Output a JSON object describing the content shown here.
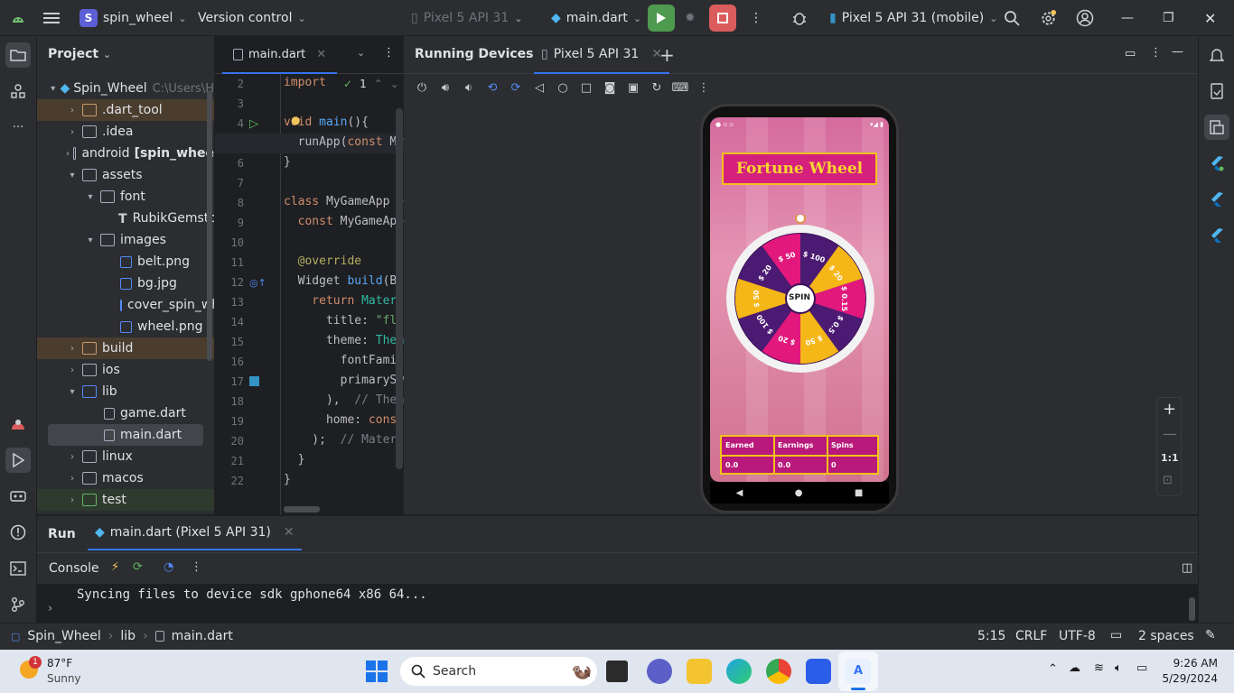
{
  "topbar": {
    "project_badge": "S",
    "project_name": "spin_wheel",
    "vcs": "Version control",
    "device_selector": "Pixel 5 API 31",
    "run_config": "main.dart",
    "target_device": "Pixel 5 API 31 (mobile)"
  },
  "project_panel": {
    "title": "Project",
    "root_name": "Spin_Wheel",
    "root_path": "C:\\Users\\H",
    "items": [
      {
        "label": ".dart_tool",
        "extra": ""
      },
      {
        "label": ".idea",
        "extra": ""
      },
      {
        "label": "android",
        "extra": "[spin_whee"
      },
      {
        "label": "assets",
        "extra": ""
      },
      {
        "label": "font",
        "extra": ""
      },
      {
        "label": "RubikGemstor",
        "extra": ""
      },
      {
        "label": "images",
        "extra": ""
      },
      {
        "label": "belt.png",
        "extra": ""
      },
      {
        "label": "bg.jpg",
        "extra": ""
      },
      {
        "label": "cover_spin_wh",
        "extra": ""
      },
      {
        "label": "wheel.png",
        "extra": ""
      },
      {
        "label": "build",
        "extra": ""
      },
      {
        "label": "ios",
        "extra": ""
      },
      {
        "label": "lib",
        "extra": ""
      },
      {
        "label": "game.dart",
        "extra": ""
      },
      {
        "label": "main.dart",
        "extra": ""
      },
      {
        "label": "linux",
        "extra": ""
      },
      {
        "label": "macos",
        "extra": ""
      },
      {
        "label": "test",
        "extra": ""
      }
    ]
  },
  "editor": {
    "tab": "main.dart",
    "problems_count": "1",
    "line_numbers": [
      "2",
      "3",
      "4",
      "5",
      "6",
      "7",
      "8",
      "9",
      "10",
      "11",
      "12",
      "13",
      "14",
      "15",
      "16",
      "17",
      "18",
      "19",
      "20",
      "21",
      "22"
    ],
    "lines": {
      "l2": "import",
      "l4a": "void",
      "l4b": "main",
      "l4c": "(){",
      "l5a": "  runApp(",
      "l5b": "const",
      "l5c": "My",
      "l6": "}",
      "l8a": "class",
      "l8b": " MyGameApp e",
      "l9a": "  const",
      "l9b": " MyGameApp",
      "l11": "  @override",
      "l12a": "  Widget ",
      "l12b": "build",
      "l12c": "(Bu",
      "l13a": "    return",
      "l13b": " Materi",
      "l14a": "      title: ",
      "l14b": "\"flu",
      "l15a": "      theme: ",
      "l15b": "Them",
      "l16": "        fontFamil",
      "l17": "        primarySw",
      "l18a": "      ),  ",
      "l18b": "// Them",
      "l19a": "      home: ",
      "l19b": "const",
      "l20a": "    );  ",
      "l20b": "// Materi",
      "l21": "  }",
      "l22": "}"
    }
  },
  "devices": {
    "title": "Running Devices",
    "device_tab": "Pixel 5 API 31",
    "zoom_reset": "1:1"
  },
  "app": {
    "title": "Fortune Wheel",
    "spin": "SPIN",
    "wheel_labels": [
      "$ 100",
      "$ 20",
      "$ 0.15",
      "$ 0.5",
      "$ 50",
      "$ 20",
      "$ 100",
      "$ 50",
      "$ 20",
      "$ 50"
    ],
    "score_headers": [
      "Earned",
      "Earnings",
      "Spins"
    ],
    "score_values": [
      "0.0",
      "0.0",
      "0"
    ]
  },
  "run_panel": {
    "tab_run": "Run",
    "tab_config": "main.dart (Pixel 5 API 31)",
    "console": "Console",
    "output": "Syncing files to device sdk gphone64 x86 64..."
  },
  "statusbar": {
    "crumbs": [
      "Spin_Wheel",
      "lib",
      "main.dart"
    ],
    "position": "5:15",
    "line_sep": "CRLF",
    "encoding": "UTF-8",
    "indent": "2 spaces"
  },
  "taskbar": {
    "weather_temp": "87°F",
    "weather_desc": "Sunny",
    "weather_badge": "1",
    "search": "Search",
    "time": "9:26 AM",
    "date": "5/29/2024"
  }
}
